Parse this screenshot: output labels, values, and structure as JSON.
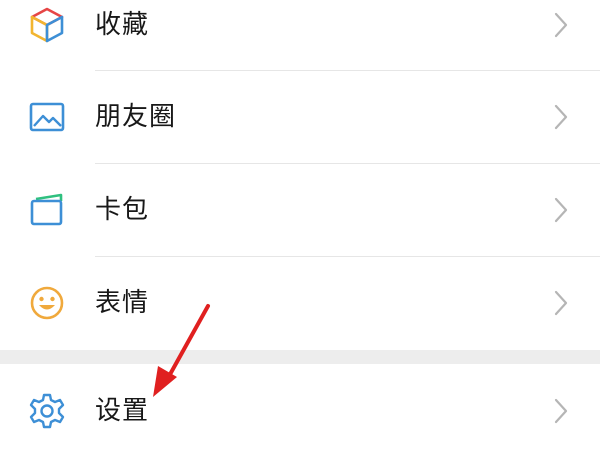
{
  "menu": {
    "items": [
      {
        "label": "收藏",
        "icon": "favorites-cube-icon"
      },
      {
        "label": "朋友圈",
        "icon": "moments-photo-icon"
      },
      {
        "label": "卡包",
        "icon": "card-wallet-icon"
      },
      {
        "label": "表情",
        "icon": "sticker-smiley-icon"
      },
      {
        "label": "设置",
        "icon": "settings-gear-icon"
      }
    ]
  },
  "colors": {
    "blue": "#3d8fd6",
    "yellow": "#f2b530",
    "red_accent": "#e64545",
    "green": "#2fc07f",
    "smiley": "#f0a93c",
    "arrow": "#e02020",
    "chevron": "#b5b5b5",
    "separator": "#ededed"
  }
}
